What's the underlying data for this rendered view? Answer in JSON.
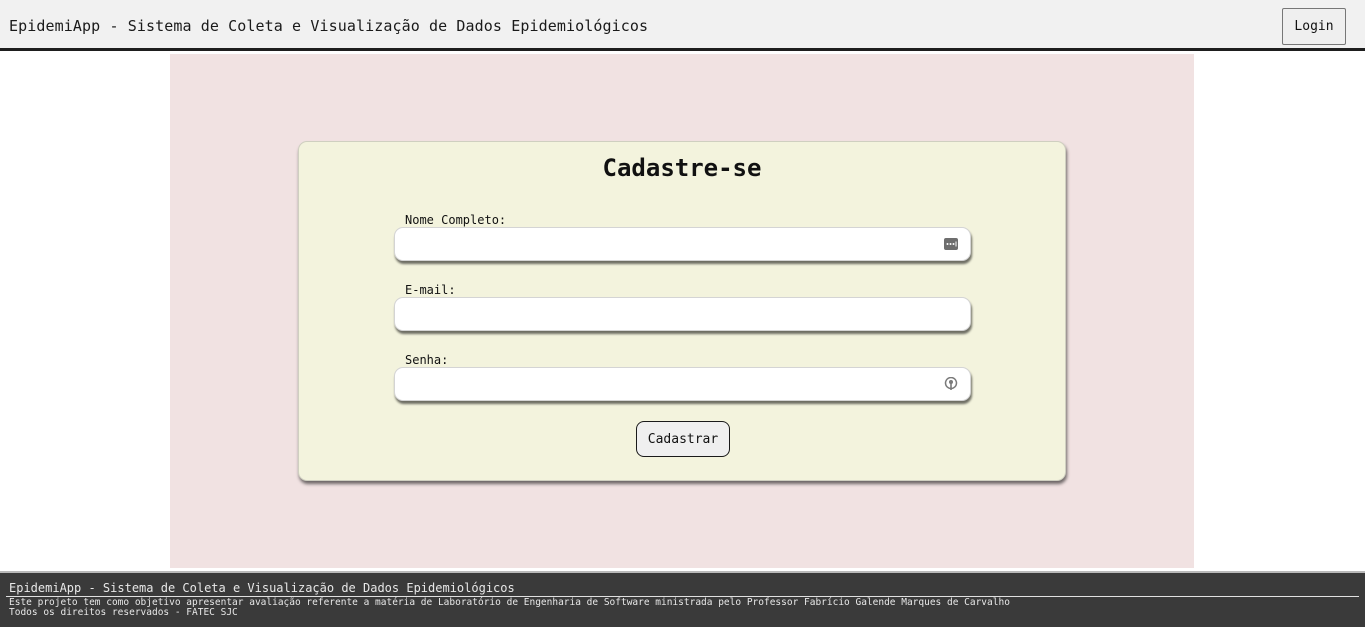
{
  "header": {
    "title": "EpidemiApp - Sistema de Coleta e Visualização de Dados Epidemiológicos",
    "login_label": "Login"
  },
  "form": {
    "title": "Cadastre-se",
    "fields": [
      {
        "label": "Nome Completo:",
        "value": "",
        "icon": "autofill-dots-icon"
      },
      {
        "label": "E-mail:",
        "value": "",
        "icon": ""
      },
      {
        "label": "Senha:",
        "value": "",
        "icon": "password-key-icon"
      }
    ],
    "submit_label": "Cadastrar"
  },
  "footer": {
    "title": "EpidemiApp - Sistema de Coleta e Visualização de Dados Epidemiológicos",
    "description": "Este projeto tem como objetivo apresentar avaliação referente a matéria de Laboratório de Engenharia de Software ministrada pelo Professor Fabrício Galende Marques de Carvalho",
    "rights": "Todos os direitos reservados - FATEC SJC"
  },
  "colors": {
    "header_bg": "#f1f1f1",
    "main_bg": "#f1e2e2",
    "card_bg": "#f3f3dd",
    "footer_bg": "#3a3a3a"
  }
}
